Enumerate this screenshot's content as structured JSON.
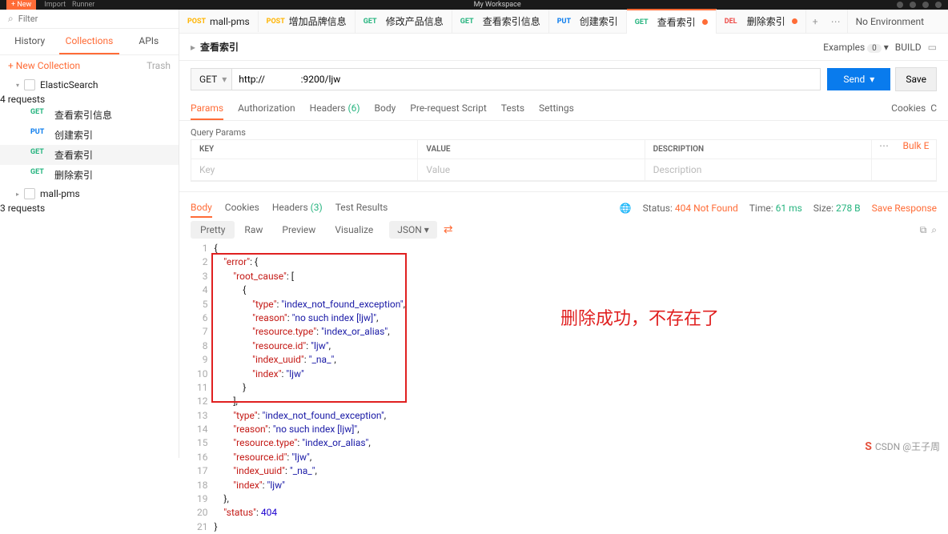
{
  "topbar": {
    "workspace": "My Workspace",
    "btns": [
      "Import",
      "Runner"
    ]
  },
  "sidebar": {
    "filter_ph": "Filter",
    "tabs": [
      "History",
      "Collections",
      "APIs"
    ],
    "new_collection": "+ New Collection",
    "trash": "Trash",
    "collections": [
      {
        "name": "ElasticSearch",
        "meta": "4 requests",
        "open": true,
        "items": [
          {
            "method": "GET",
            "name": "查看索引信息"
          },
          {
            "method": "PUT",
            "name": "创建索引"
          },
          {
            "method": "GET",
            "name": "查看索引",
            "active": true
          },
          {
            "method": "GET",
            "name": "删除索引"
          }
        ]
      },
      {
        "name": "mall-pms",
        "meta": "3 requests",
        "open": false
      }
    ]
  },
  "tabs": [
    {
      "method": "POST",
      "label": "mall-pms"
    },
    {
      "method": "POST",
      "label": "增加品牌信息"
    },
    {
      "method": "GET",
      "label": "修改产品信息"
    },
    {
      "method": "GET",
      "label": "查看索引信息"
    },
    {
      "method": "PUT",
      "label": "创建索引"
    },
    {
      "method": "GET",
      "label": "查看索引",
      "dirty": true,
      "active": true
    },
    {
      "method": "DEL",
      "label": "删除索引",
      "dirty": true
    }
  ],
  "env": {
    "label": "No Environment"
  },
  "request": {
    "title": "查看索引",
    "examples": "Examples",
    "examples_count": "0",
    "build": "BUILD",
    "method": "GET",
    "url": "http://               :9200/ljw",
    "send": "Send",
    "save": "Save",
    "tabs": {
      "params": "Params",
      "auth": "Authorization",
      "headers": "Headers",
      "headers_count": "(6)",
      "body": "Body",
      "prereq": "Pre-request Script",
      "tests": "Tests",
      "settings": "Settings",
      "cookies": "Cookies",
      "code": "C"
    },
    "qp_title": "Query Params",
    "table": {
      "hkey": "KEY",
      "hvalue": "VALUE",
      "hdesc": "DESCRIPTION",
      "bulk": "Bulk E",
      "key_ph": "Key",
      "val_ph": "Value",
      "desc_ph": "Description"
    }
  },
  "response": {
    "tabs": {
      "body": "Body",
      "cookies": "Cookies",
      "headers": "Headers",
      "headers_count": "(3)",
      "tests": "Test Results"
    },
    "status_label": "Status:",
    "status": "404 Not Found",
    "time_label": "Time:",
    "time": "61 ms",
    "size_label": "Size:",
    "size": "278 B",
    "save": "Save Response",
    "view": {
      "pretty": "Pretty",
      "raw": "Raw",
      "preview": "Preview",
      "visualize": "Visualize",
      "format": "JSON"
    },
    "lines": [
      "{",
      "    \"error\": {",
      "        \"root_cause\": [",
      "            {",
      "                \"type\": \"index_not_found_exception\",",
      "                \"reason\": \"no such index [ljw]\",",
      "                \"resource.type\": \"index_or_alias\",",
      "                \"resource.id\": \"ljw\",",
      "                \"index_uuid\": \"_na_\",",
      "                \"index\": \"ljw\"",
      "            }",
      "        ],",
      "        \"type\": \"index_not_found_exception\",",
      "        \"reason\": \"no such index [ljw]\",",
      "        \"resource.type\": \"index_or_alias\",",
      "        \"resource.id\": \"ljw\",",
      "        \"index_uuid\": \"_na_\",",
      "        \"index\": \"ljw\"",
      "    },",
      "    \"status\": 404",
      "}"
    ]
  },
  "annotation": "删除成功，不存在了",
  "watermark": "CSDN @王子周"
}
